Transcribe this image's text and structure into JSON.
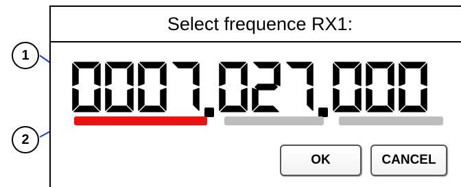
{
  "dialog": {
    "title": "Select frequence RX1:",
    "frequency": "0007.027.000",
    "groups": [
      "0007",
      "027",
      "000"
    ],
    "active_group_index": 0,
    "colors": {
      "active_bar": "#ee1111",
      "inactive_bar": "#bdbdbd",
      "leader_line": "#1a3fd6"
    },
    "ok_label": "OK",
    "cancel_label": "CANCEL"
  },
  "callouts": [
    {
      "label": "1",
      "target": "frequency-display"
    },
    {
      "label": "2",
      "target": "group-indicator-bar"
    }
  ]
}
